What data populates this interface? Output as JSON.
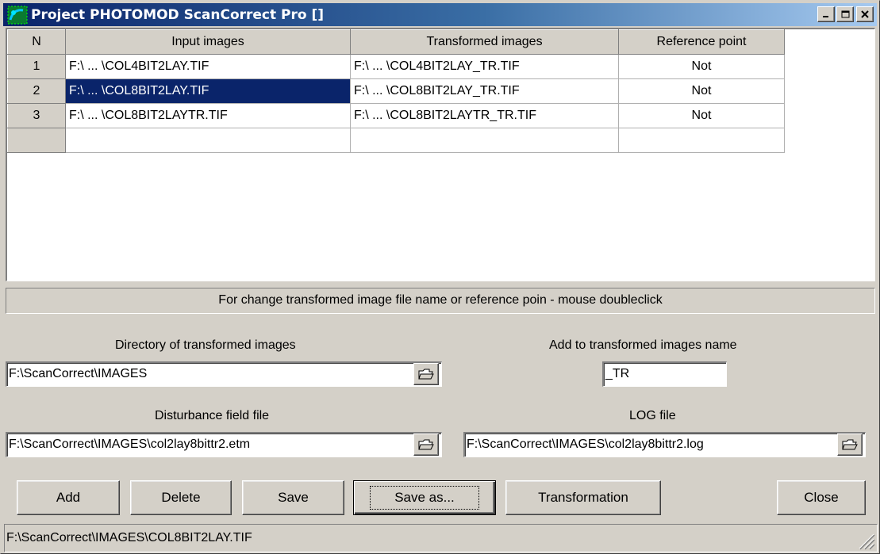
{
  "window": {
    "title": "Project PHOTOMOD ScanCorrect Pro []",
    "titlebar_buttons": {
      "minimize": "_",
      "maximize": "□",
      "close": "×"
    }
  },
  "grid": {
    "columns": [
      "N",
      "Input images",
      "Transformed images",
      "Reference point"
    ],
    "rows": [
      {
        "n": "1",
        "input": "F:\\ ... \\COL4BIT2LAY.TIF",
        "transformed": "F:\\ ... \\COL4BIT2LAY_TR.TIF",
        "reference": "Not"
      },
      {
        "n": "2",
        "input": "F:\\ ... \\COL8BIT2LAY.TIF",
        "transformed": "F:\\ ... \\COL8BIT2LAY_TR.TIF",
        "reference": "Not"
      },
      {
        "n": "3",
        "input": "F:\\ ... \\COL8BIT2LAYTR.TIF",
        "transformed": "F:\\ ... \\COL8BIT2LAYTR_TR.TIF",
        "reference": "Not"
      },
      {
        "n": "",
        "input": "",
        "transformed": "",
        "reference": ""
      }
    ],
    "selected_row": 2
  },
  "hint": "For change transformed image file name or reference poin - mouse doubleclick",
  "fields": {
    "transformed_dir_label": "Directory of transformed images",
    "transformed_dir_value": "F:\\ScanCorrect\\IMAGES",
    "suffix_label": "Add to transformed images name",
    "suffix_value": "_TR",
    "disturbance_label": "Disturbance field file",
    "disturbance_value": "F:\\ScanCorrect\\IMAGES\\col2lay8bittr2.etm",
    "log_label": "LOG file",
    "log_value": "F:\\ScanCorrect\\IMAGES\\col2lay8bittr2.log"
  },
  "buttons": {
    "add": "Add",
    "delete": "Delete",
    "save": "Save",
    "save_as": "Save as...",
    "transformation": "Transformation",
    "close": "Close"
  },
  "status": "F:\\ScanCorrect\\IMAGES\\COL8BIT2LAY.TIF",
  "icons": {
    "app": "photomod-app-icon",
    "browse": "folder-open-icon",
    "grip": "resize-grip-icon"
  },
  "colors": {
    "selection": "#0a246a",
    "face": "#d4d0c8",
    "title_start": "#0a246a",
    "title_end": "#a6caf0"
  }
}
